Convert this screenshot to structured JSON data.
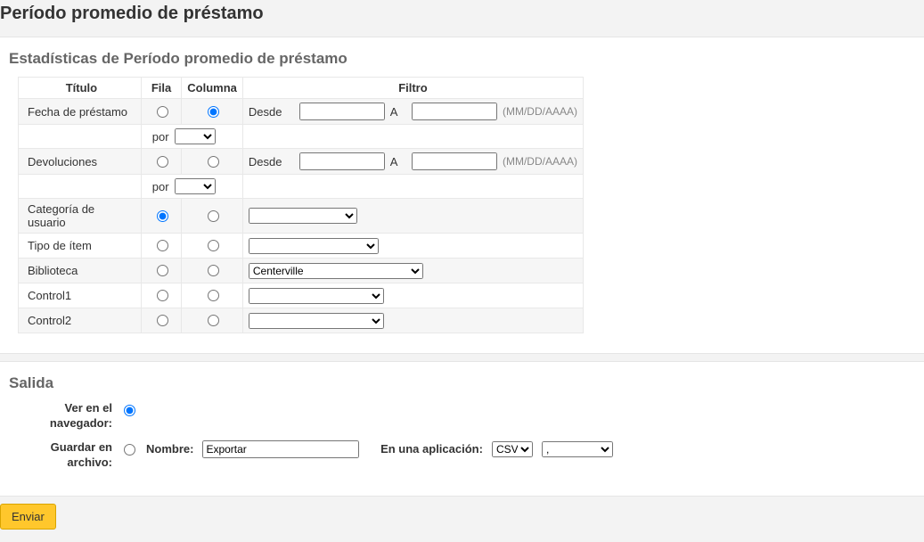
{
  "page_title": "Período promedio de préstamo",
  "stats": {
    "heading": "Estadísticas de Período promedio de préstamo",
    "headers": {
      "title": "Título",
      "row": "Fila",
      "col": "Columna",
      "filter": "Filtro"
    },
    "rows": {
      "fecha_prestamo": {
        "title": "Fecha de préstamo",
        "from_label": "Desde",
        "to_label": "A",
        "hint": "(MM/DD/AAAA)",
        "por_label": "por"
      },
      "devoluciones": {
        "title": "Devoluciones",
        "from_label": "Desde",
        "to_label": "A",
        "hint": "(MM/DD/AAAA)",
        "por_label": "por"
      },
      "categoria_usuario": {
        "title": "Categoría de usuario"
      },
      "tipo_item": {
        "title": "Tipo de ítem"
      },
      "biblioteca": {
        "title": "Biblioteca",
        "selected": "Centerville"
      },
      "control1": {
        "title": "Control1"
      },
      "control2": {
        "title": "Control2"
      }
    }
  },
  "output": {
    "heading": "Salida",
    "view_browser_label": "Ver en el navegador:",
    "save_file_label": "Guardar en archivo:",
    "name_label": "Nombre:",
    "name_value": "Exportar",
    "app_label": "En una aplicación:",
    "format_selected": "CSV",
    "delim_selected": ","
  },
  "submit_label": "Enviar"
}
